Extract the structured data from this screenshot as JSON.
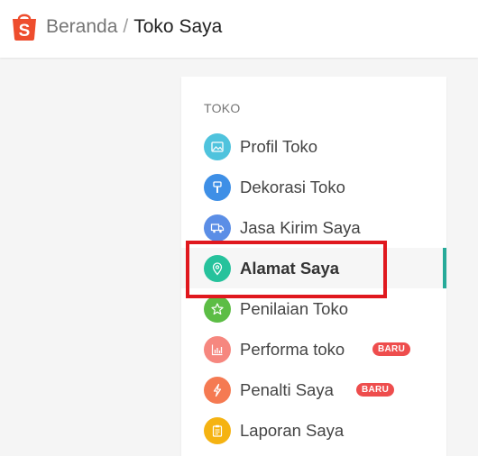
{
  "header": {
    "breadcrumb_home": "Beranda",
    "breadcrumb_separator": "/",
    "breadcrumb_current": "Toko Saya"
  },
  "logo": {
    "glyph": "S",
    "color": "#ee4d2d"
  },
  "sidebar": {
    "section_title": "TOKO",
    "items": [
      {
        "label": "Profil Toko",
        "icon": "image-icon",
        "color": "#4fc3dd",
        "active": false
      },
      {
        "label": "Dekorasi Toko",
        "icon": "brush-icon",
        "color": "#3e8fe6",
        "active": false
      },
      {
        "label": "Jasa Kirim Saya",
        "icon": "truck-icon",
        "color": "#5b8ee6",
        "active": false
      },
      {
        "label": "Alamat Saya",
        "icon": "location-pin-icon",
        "color": "#26c29c",
        "active": true
      },
      {
        "label": "Penilaian Toko",
        "icon": "star-icon",
        "color": "#5cbd45",
        "active": false
      },
      {
        "label": "Performa toko",
        "icon": "bar-chart-icon",
        "color": "#f6877f",
        "active": false,
        "badge": "BARU"
      },
      {
        "label": "Penalti Saya",
        "icon": "lightning-icon",
        "color": "#f57a52",
        "active": false,
        "badge": "BARU"
      },
      {
        "label": "Laporan Saya",
        "icon": "clipboard-icon",
        "color": "#f5b312",
        "active": false
      }
    ]
  },
  "colors": {
    "accent_active": "#26aa99",
    "badge": "#ee4d4d",
    "highlight": "#e0181e"
  }
}
